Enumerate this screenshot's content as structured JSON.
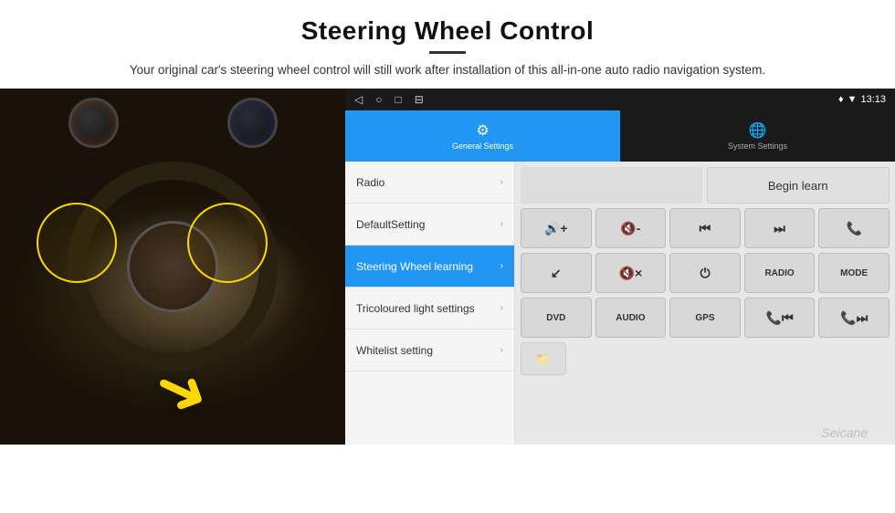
{
  "header": {
    "title": "Steering Wheel Control",
    "description": "Your original car's steering wheel control will still work after installation of this all-in-one auto radio navigation system."
  },
  "status_bar": {
    "time": "13:13",
    "icons": [
      "◁",
      "○",
      "□",
      "⊟"
    ]
  },
  "tabs": [
    {
      "id": "general",
      "label": "General Settings",
      "icon": "⚙",
      "active": true
    },
    {
      "id": "system",
      "label": "System Settings",
      "icon": "🌐",
      "active": false
    }
  ],
  "menu_items": [
    {
      "id": "radio",
      "label": "Radio",
      "active": false
    },
    {
      "id": "default",
      "label": "DefaultSetting",
      "active": false
    },
    {
      "id": "steering",
      "label": "Steering Wheel learning",
      "active": true
    },
    {
      "id": "tricoloured",
      "label": "Tricoloured light settings",
      "active": false
    },
    {
      "id": "whitelist",
      "label": "Whitelist setting",
      "active": false
    }
  ],
  "controls": {
    "begin_learn": "Begin learn",
    "buttons_row1": [
      {
        "id": "vol-up",
        "label": "🔊+",
        "symbol": "🔊+"
      },
      {
        "id": "vol-down",
        "label": "🔇-",
        "symbol": "🔇-"
      },
      {
        "id": "prev-track",
        "label": "⏮",
        "symbol": "⏮"
      },
      {
        "id": "next-track",
        "label": "⏭",
        "symbol": "⏭"
      },
      {
        "id": "phone",
        "label": "📞",
        "symbol": "📞"
      }
    ],
    "buttons_row2": [
      {
        "id": "hang-up",
        "label": "☎",
        "symbol": "↙"
      },
      {
        "id": "mute",
        "label": "🔇×",
        "symbol": "🔇×"
      },
      {
        "id": "power",
        "label": "⏻",
        "symbol": "⏻"
      },
      {
        "id": "radio-btn",
        "label": "RADIO",
        "symbol": "RADIO"
      },
      {
        "id": "mode",
        "label": "MODE",
        "symbol": "MODE"
      }
    ],
    "buttons_row3": [
      {
        "id": "dvd",
        "label": "DVD",
        "symbol": "DVD"
      },
      {
        "id": "audio",
        "label": "AUDIO",
        "symbol": "AUDIO"
      },
      {
        "id": "gps",
        "label": "GPS",
        "symbol": "GPS"
      },
      {
        "id": "tel-prev",
        "label": "📞⏮",
        "symbol": "📞⏮"
      },
      {
        "id": "tel-next",
        "label": "📞⏭",
        "symbol": "📞⏭"
      }
    ]
  },
  "watermark": "Seicane"
}
